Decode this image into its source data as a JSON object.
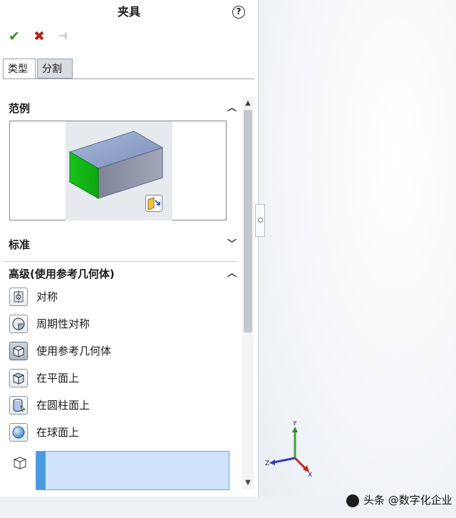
{
  "panel": {
    "title": "夹具",
    "help_glyph": "?",
    "toolbar": {
      "ok_glyph": "✔",
      "cancel_glyph": "✖",
      "pin_glyph": "⊣"
    },
    "tabs": [
      {
        "label": "类型"
      },
      {
        "label": "分割"
      }
    ],
    "sections": {
      "example": {
        "label": "范例",
        "expanded": true
      },
      "standard": {
        "label": "标准",
        "expanded": false
      },
      "advanced": {
        "label": "高级(使用参考几何体)",
        "expanded": true
      }
    },
    "advanced_items": [
      {
        "label": "对称",
        "icon": "symmetry-icon",
        "selected": false
      },
      {
        "label": "周期性对称",
        "icon": "cyclic-symmetry-icon",
        "selected": false
      },
      {
        "label": "使用参考几何体",
        "icon": "reference-geometry-icon",
        "selected": true
      },
      {
        "label": "在平面上",
        "icon": "on-flat-face-icon",
        "selected": false
      },
      {
        "label": "在圆柱面上",
        "icon": "on-cylindrical-face-icon",
        "selected": false
      },
      {
        "label": "在球面上",
        "icon": "on-spherical-face-icon",
        "selected": false
      }
    ]
  },
  "triad": {
    "x": "X",
    "y": "Y",
    "z": "Z"
  },
  "watermark": "头条 @数字化企业",
  "colors": {
    "accent": "#4a9ae2",
    "selection_fill": "#cfe3fb",
    "ok": "#3c8f26",
    "cancel": "#b8261c",
    "face_green": "#18c21a",
    "box_blue": "#8d9ec9"
  }
}
